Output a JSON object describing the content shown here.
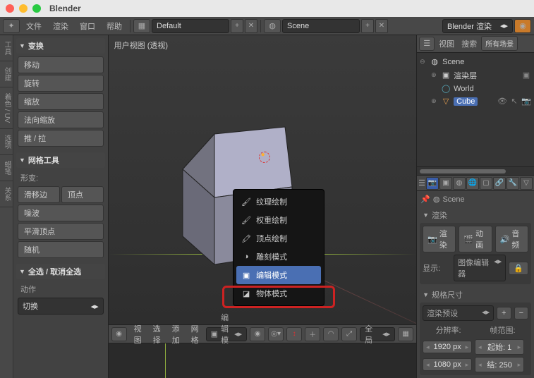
{
  "app": {
    "title": "Blender"
  },
  "topbar": {
    "menu": {
      "file": "文件",
      "render": "渲染",
      "window": "窗口",
      "help": "帮助"
    },
    "layout_dropdown": "Default",
    "scene_dropdown": "Scene",
    "engine_dropdown": "Blender 渲染"
  },
  "left": {
    "vtabs": [
      "工具",
      "创建",
      "着色 / UV",
      "选项",
      "蜡笔",
      "关系"
    ],
    "transform": {
      "title": "变换",
      "translate": "移动",
      "rotate": "旋转",
      "scale": "缩放",
      "normal_scale": "法向缩放",
      "push_pull": "推 / 拉"
    },
    "meshtools": {
      "title": "网格工具",
      "deform_label": "形变:",
      "edge_slide": "滑移边",
      "vertex": "顶点",
      "noise": "噪波",
      "smooth_vertex": "平滑顶点",
      "random": "随机"
    },
    "select": {
      "title": "全选 / 取消全选",
      "action_label": "动作",
      "toggle": "切换"
    }
  },
  "viewport": {
    "label": "用户视图  (透视)"
  },
  "vpbar": {
    "view": "视图",
    "select": "选择",
    "add": "添加",
    "mesh": "网格",
    "mode_field": "编辑模式",
    "global": "全局"
  },
  "mode_menu": {
    "texture_paint": "纹理绘制",
    "weight_paint": "权重绘制",
    "vertex_paint": "顶点绘制",
    "sculpt": "雕刻模式",
    "edit": "编辑模式",
    "object": "物体模式"
  },
  "outliner": {
    "view": "视图",
    "search": "搜索",
    "all_scenes": "所有场景",
    "scene": "Scene",
    "render_layers": "渲染层",
    "world": "World",
    "cube": "Cube"
  },
  "props": {
    "crumb_scene": "Scene",
    "render": {
      "title": "渲染",
      "render_btn": "渲染",
      "anim_btn": "动画",
      "audio_btn": "音频",
      "display_label": "显示:",
      "image_editor": "图像编辑器"
    },
    "dimensions": {
      "title": "规格尺寸",
      "preset": "渲染预设",
      "res_label": "分辨率:",
      "frame_label": "帧范围:",
      "res_x": "1920 px",
      "res_y": "1080 px",
      "start_label": "起始:",
      "start": "1",
      "end_label": "结:",
      "end": "250"
    }
  }
}
